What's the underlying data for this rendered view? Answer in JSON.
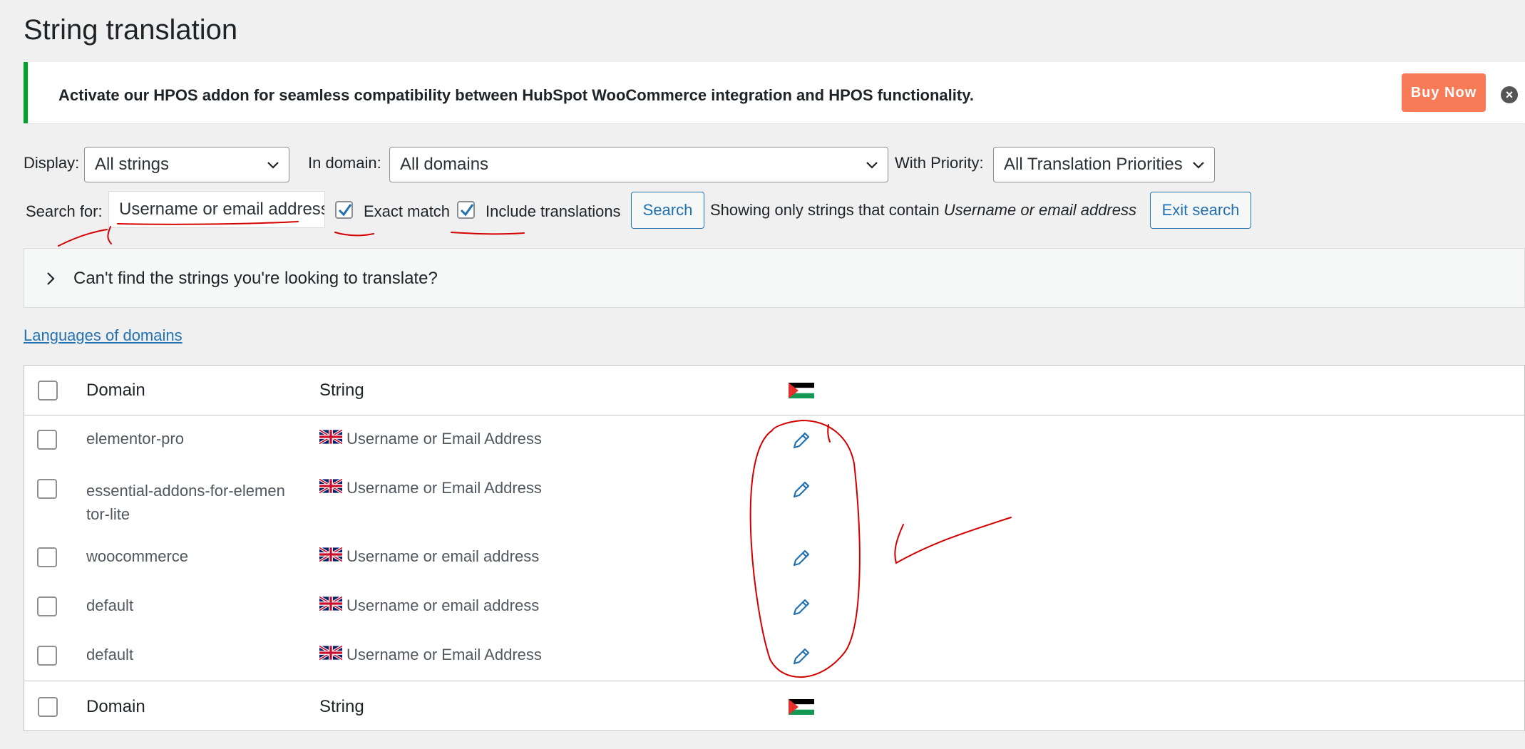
{
  "page": {
    "title": "String translation"
  },
  "notice": {
    "text": "Activate our HPOS addon for seamless compatibility between HubSpot WooCommerce integration and HPOS functionality.",
    "buy_label": "Buy Now",
    "dismiss_icon": "close-circle-icon"
  },
  "filters": {
    "display_label": "Display:",
    "display_value": "All strings",
    "domain_label": "In domain:",
    "domain_value": "All domains",
    "priority_label": "With Priority:",
    "priority_value": "All Translation Priorities"
  },
  "search": {
    "label": "Search for:",
    "value": "Username or email address",
    "exact_match_label": "Exact match",
    "exact_match_checked": true,
    "include_translations_label": "Include translations",
    "include_translations_checked": true,
    "search_button": "Search",
    "showing_prefix": "Showing only strings that contain",
    "showing_term": "Username or email address",
    "exit_button": "Exit search"
  },
  "help": {
    "toggle_label": "Can't find the strings you're looking to translate?"
  },
  "languages_link": "Languages of domains",
  "table": {
    "header": {
      "domain": "Domain",
      "string": "String",
      "language_flag": "palestine-flag-icon"
    },
    "rows": [
      {
        "domain": "elementor-pro",
        "string": "Username or Email Address"
      },
      {
        "domain": "essential-addons-for-elemen",
        "domain_line2": "tor-lite",
        "string": "Username or Email Address"
      },
      {
        "domain": "woocommerce",
        "string": "Username or email address"
      },
      {
        "domain": "default",
        "string": "Username or email address"
      },
      {
        "domain": "default",
        "string": "Username or Email Address"
      }
    ],
    "footer": {
      "domain": "Domain",
      "string": "String"
    }
  },
  "colors": {
    "accent": "#2271b1",
    "notice_border": "#00a32a",
    "buy_button": "#f87b57",
    "annotation": "#d40000"
  }
}
